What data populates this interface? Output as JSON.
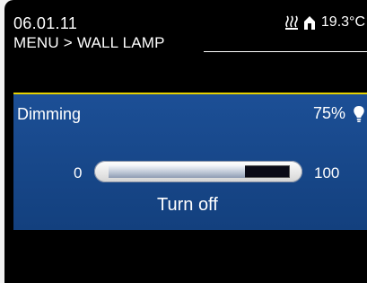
{
  "header": {
    "date": "06.01.11",
    "temperature": "19.3°C",
    "status_icons": [
      "heating-icon",
      "house-icon"
    ]
  },
  "breadcrumb": "MENU > WALL LAMP",
  "dimming": {
    "label": "Dimming",
    "value_text": "75%",
    "level_percent": 75,
    "min": "0",
    "max": "100",
    "icon": "bulb-icon",
    "action": "Turn off"
  },
  "colors": {
    "background": "#000000",
    "panel": "#1c4f96",
    "accent": "#e6d200",
    "text": "#ffffff"
  }
}
